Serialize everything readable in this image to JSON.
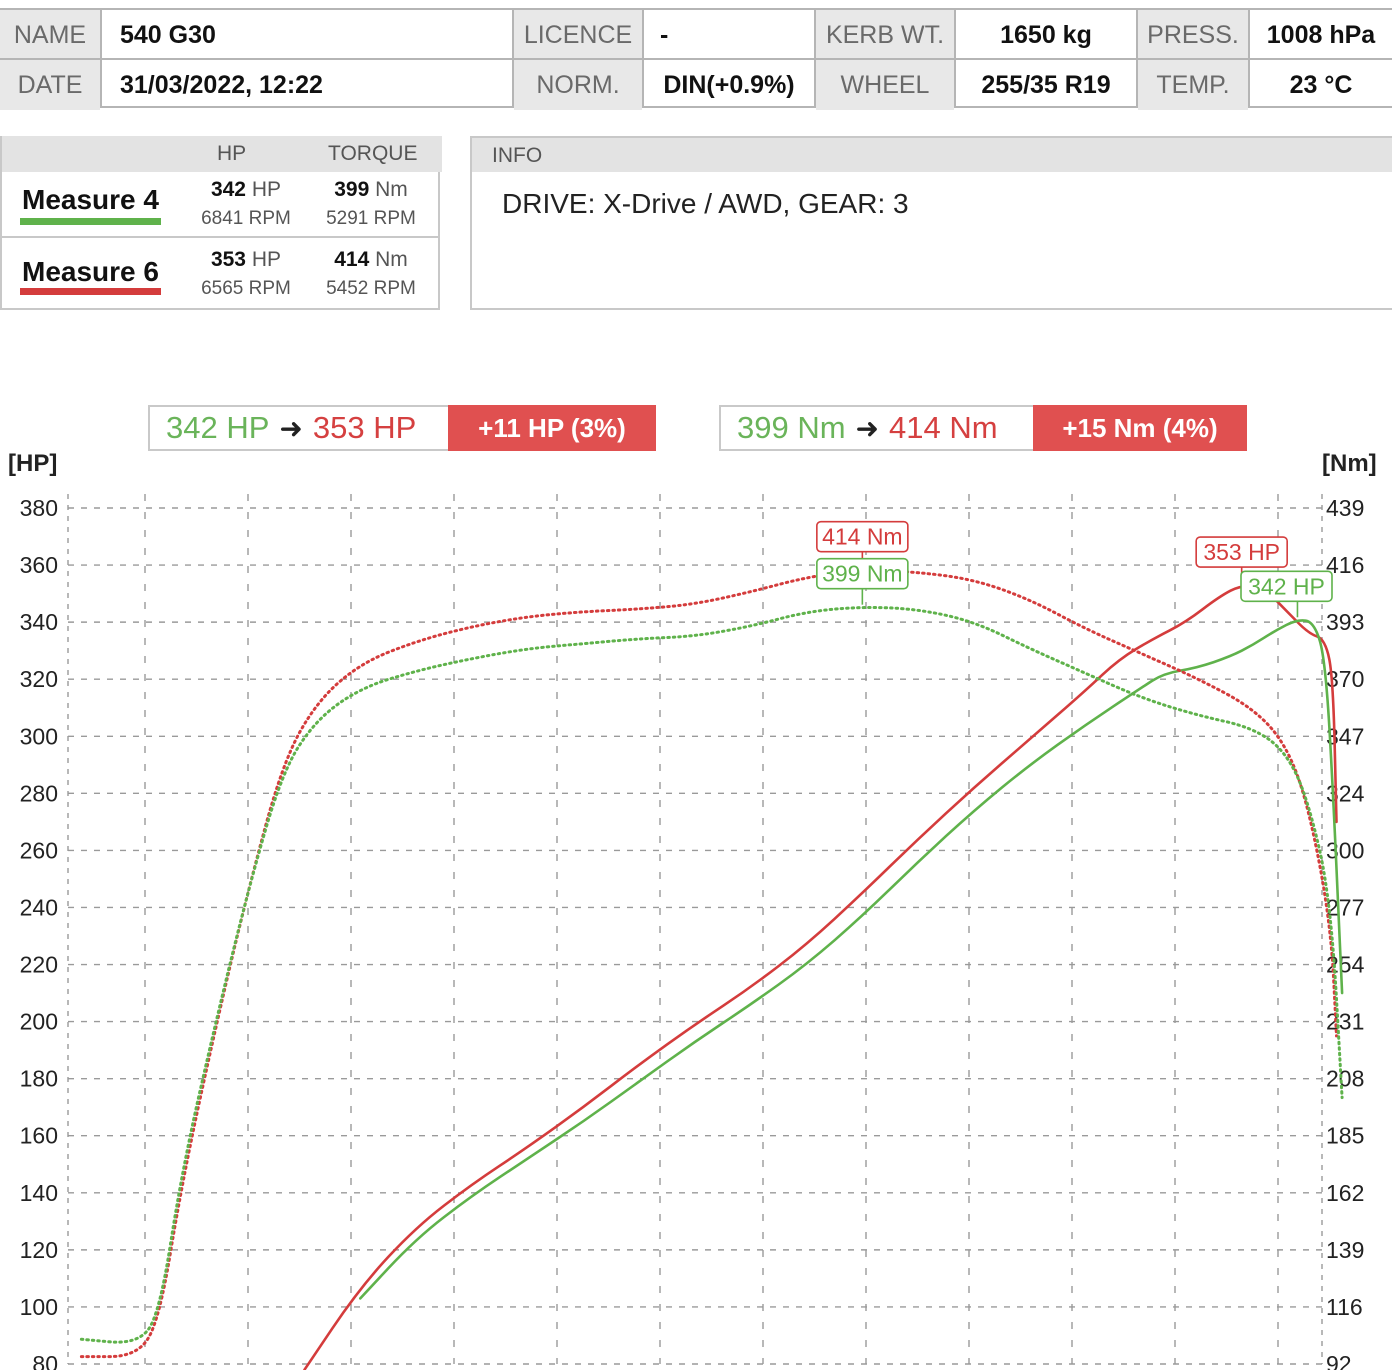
{
  "header": {
    "name_label": "NAME",
    "name_value": "540 G30",
    "date_label": "DATE",
    "date_value": "31/03/2022, 12:22",
    "licence_label": "LICENCE",
    "licence_value": "-",
    "norm_label": "NORM.",
    "norm_value": "DIN(+0.9%)",
    "kerb_label": "KERB WT.",
    "kerb_value": "1650 kg",
    "wheel_label": "WHEEL",
    "wheel_value": "255/35 R19",
    "press_label": "PRESS.",
    "press_value": "1008 hPa",
    "temp_label": "TEMP.",
    "temp_value": "23 °C"
  },
  "measures": {
    "col_hp": "HP",
    "col_torque": "TORQUE",
    "rows": [
      {
        "name": "Measure 4",
        "color": "#5fb24b",
        "hp": "342",
        "hp_unit": "HP",
        "hp_rpm": "6841 RPM",
        "tq": "399",
        "tq_unit": "Nm",
        "tq_rpm": "5291 RPM"
      },
      {
        "name": "Measure 6",
        "color": "#d43c3c",
        "hp": "353",
        "hp_unit": "HP",
        "hp_rpm": "6565 RPM",
        "tq": "414",
        "tq_unit": "Nm",
        "tq_rpm": "5452 RPM"
      }
    ]
  },
  "info": {
    "title": "INFO",
    "text": "DRIVE: X-Drive / AWD,  GEAR: 3"
  },
  "comparison": {
    "hp_before": "342 HP",
    "hp_after": "353 HP",
    "hp_delta": "+11 HP  (3%)",
    "tq_before": "399 Nm",
    "tq_after": "414 Nm",
    "tq_delta": "+15 Nm  (4%)",
    "arrow": "➜"
  },
  "colors": {
    "measure4": "#5fb24b",
    "measure6": "#d43c3c",
    "grid": "#9a9a9a"
  },
  "chart_data": {
    "type": "line",
    "y_left_label": "[HP]",
    "y_right_label": "[Nm]",
    "y_left_ticks": [
      80,
      100,
      120,
      140,
      160,
      180,
      200,
      220,
      240,
      260,
      280,
      300,
      320,
      340,
      360,
      380
    ],
    "y_right_ticks": [
      92,
      116,
      139,
      162,
      185,
      208,
      231,
      254,
      277,
      300,
      324,
      347,
      370,
      393,
      416,
      439
    ],
    "y_left_range": [
      80,
      380
    ],
    "y_right_range": [
      92,
      439
    ],
    "x_range": [
      0,
      1
    ],
    "annotations": [
      {
        "text": "414 Nm",
        "series": "Measure 6 torque"
      },
      {
        "text": "353 HP",
        "series": "Measure 6 power"
      },
      {
        "text": "399 Nm",
        "series": "Measure 4 torque"
      },
      {
        "text": "342 HP",
        "series": "Measure 4 power"
      }
    ],
    "series": [
      {
        "name": "Measure 6 power",
        "axis": "left",
        "style": "solid",
        "color": "#d43c3c",
        "points": [
          [
            0.15,
            78
          ],
          [
            0.2,
            107
          ],
          [
            0.25,
            128
          ],
          [
            0.3,
            143
          ],
          [
            0.35,
            156
          ],
          [
            0.4,
            170
          ],
          [
            0.45,
            185
          ],
          [
            0.5,
            199
          ],
          [
            0.55,
            212
          ],
          [
            0.6,
            227
          ],
          [
            0.65,
            245
          ],
          [
            0.7,
            264
          ],
          [
            0.75,
            282
          ],
          [
            0.8,
            299
          ],
          [
            0.85,
            316
          ],
          [
            0.88,
            327
          ],
          [
            0.91,
            334
          ],
          [
            0.94,
            340
          ],
          [
            0.97,
            349
          ],
          [
            0.99,
            353
          ],
          [
            1.01,
            352
          ],
          [
            1.03,
            344
          ],
          [
            1.05,
            336
          ],
          [
            1.065,
            334
          ],
          [
            1.072,
            320
          ],
          [
            1.075,
            270
          ]
        ]
      },
      {
        "name": "Measure 4 power",
        "axis": "left",
        "style": "solid",
        "color": "#5fb24b",
        "points": [
          [
            0.2,
            103
          ],
          [
            0.25,
            124
          ],
          [
            0.3,
            139
          ],
          [
            0.35,
            152
          ],
          [
            0.4,
            165
          ],
          [
            0.45,
            179
          ],
          [
            0.5,
            193
          ],
          [
            0.55,
            206
          ],
          [
            0.6,
            220
          ],
          [
            0.65,
            237
          ],
          [
            0.7,
            256
          ],
          [
            0.75,
            274
          ],
          [
            0.8,
            290
          ],
          [
            0.85,
            304
          ],
          [
            0.9,
            317
          ],
          [
            0.92,
            322
          ],
          [
            0.95,
            324
          ],
          [
            0.98,
            328
          ],
          [
            1.0,
            332
          ],
          [
            1.02,
            337
          ],
          [
            1.04,
            341
          ],
          [
            1.055,
            340
          ],
          [
            1.065,
            327
          ],
          [
            1.072,
            280
          ],
          [
            1.08,
            210
          ]
        ]
      },
      {
        "name": "Measure 6 torque",
        "axis": "right",
        "style": "dotted",
        "color": "#d43c3c",
        "points": [
          [
            -0.05,
            95
          ],
          [
            0.0,
            95
          ],
          [
            0.02,
            110
          ],
          [
            0.04,
            165
          ],
          [
            0.07,
            228
          ],
          [
            0.1,
            285
          ],
          [
            0.13,
            335
          ],
          [
            0.16,
            360
          ],
          [
            0.2,
            376
          ],
          [
            0.25,
            385
          ],
          [
            0.3,
            391
          ],
          [
            0.35,
            395
          ],
          [
            0.4,
            397
          ],
          [
            0.45,
            398
          ],
          [
            0.5,
            400
          ],
          [
            0.55,
            405
          ],
          [
            0.6,
            411
          ],
          [
            0.65,
            414
          ],
          [
            0.7,
            413
          ],
          [
            0.75,
            410
          ],
          [
            0.8,
            402
          ],
          [
            0.85,
            390
          ],
          [
            0.9,
            380
          ],
          [
            0.95,
            370
          ],
          [
            1.0,
            358
          ],
          [
            1.03,
            343
          ],
          [
            1.05,
            318
          ],
          [
            1.07,
            270
          ],
          [
            1.075,
            225
          ]
        ]
      },
      {
        "name": "Measure 4 torque",
        "axis": "right",
        "style": "dotted",
        "color": "#5fb24b",
        "points": [
          [
            -0.05,
            102
          ],
          [
            0.0,
            100
          ],
          [
            0.02,
            112
          ],
          [
            0.04,
            170
          ],
          [
            0.07,
            230
          ],
          [
            0.1,
            285
          ],
          [
            0.13,
            332
          ],
          [
            0.16,
            353
          ],
          [
            0.2,
            366
          ],
          [
            0.25,
            373
          ],
          [
            0.3,
            378
          ],
          [
            0.35,
            382
          ],
          [
            0.4,
            384
          ],
          [
            0.45,
            386
          ],
          [
            0.5,
            387
          ],
          [
            0.55,
            391
          ],
          [
            0.6,
            397
          ],
          [
            0.65,
            399
          ],
          [
            0.7,
            398
          ],
          [
            0.75,
            393
          ],
          [
            0.8,
            382
          ],
          [
            0.85,
            372
          ],
          [
            0.9,
            362
          ],
          [
            0.95,
            355
          ],
          [
            1.0,
            350
          ],
          [
            1.03,
            340
          ],
          [
            1.05,
            320
          ],
          [
            1.07,
            280
          ],
          [
            1.08,
            200
          ]
        ]
      }
    ]
  }
}
